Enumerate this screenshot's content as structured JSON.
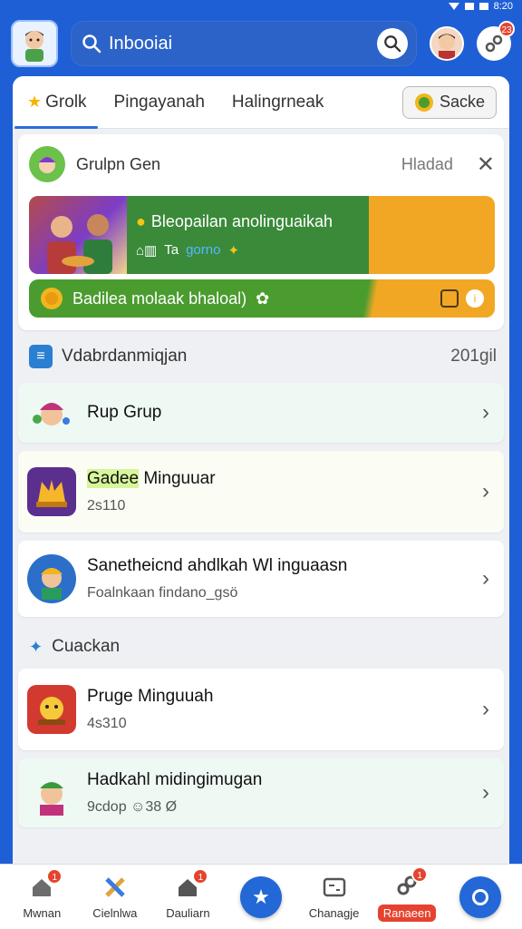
{
  "status_bar": {
    "time": "8:20",
    "signal_label": "HI"
  },
  "header": {
    "search_text": "Inbooiai",
    "notifications_badge": "23"
  },
  "tabs": {
    "items": [
      {
        "label": "Grolk"
      },
      {
        "label": "Pingayanah"
      },
      {
        "label": "Halingrneak"
      }
    ],
    "action_label": "Sacke"
  },
  "group_card": {
    "title": "Grulpn Gen",
    "status": "Hladad",
    "banner1": {
      "title": "Bleopailan anolinguaikah",
      "sub_prefix": "⌂▥",
      "sub_text": "Ta",
      "sub_highlight": "gorno"
    },
    "banner2": {
      "text": "Badilea molaak bhaloal)"
    }
  },
  "section1": {
    "title": "Vdabrdanmiqjan",
    "count": "201gil"
  },
  "items": [
    {
      "title": "Rup Grup",
      "subtitle": ""
    },
    {
      "title_highlight": "Gadee",
      "title": "Minguuar",
      "subtitle": "2s110"
    },
    {
      "title": "Sanetheicnd ahdlkah Wl inguaasn",
      "subtitle": "Foalnkaan findano_gsö"
    }
  ],
  "section2": {
    "title": "Cuackan"
  },
  "items2": [
    {
      "title": "Pruge Minguuah",
      "subtitle": "4s310"
    },
    {
      "title": "Hadkahl midingimugan",
      "subtitle": "9cdop ☺38 Ø"
    }
  ],
  "nav": {
    "items": [
      {
        "label": "Mwnan",
        "badge": "1"
      },
      {
        "label": "Cielnlwa",
        "badge": ""
      },
      {
        "label": "Dauliarn",
        "badge": "1"
      },
      {
        "label": "",
        "badge": ""
      },
      {
        "label": "Chanagje",
        "badge": ""
      },
      {
        "label": "Ranaeen",
        "badge": "1"
      },
      {
        "label": "",
        "badge": ""
      }
    ]
  }
}
